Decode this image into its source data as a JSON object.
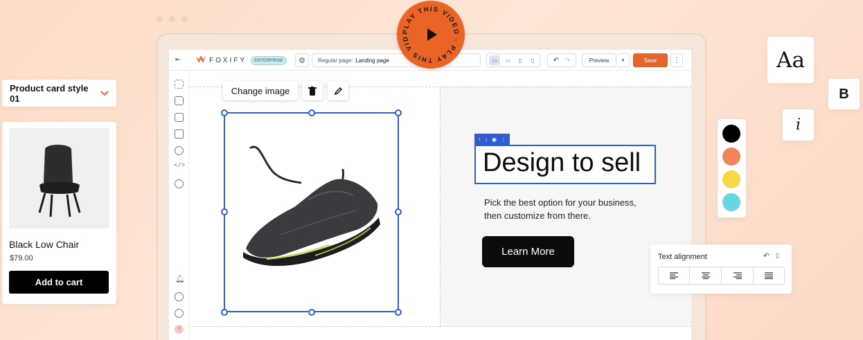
{
  "topbar": {
    "brand": "FOXIFY",
    "badge": "ENTERPRISE",
    "page_prefix": "Regular page:",
    "page_name": "Landing page",
    "preview_label": "Preview",
    "save_label": "Save"
  },
  "image_toolbar": {
    "change_image_label": "Change image"
  },
  "hero": {
    "headline": "Design to sell",
    "description": "Pick the best option for your business, then customize from there.",
    "cta_label": "Learn More"
  },
  "product_card_style": {
    "selected": "Product card style 01"
  },
  "product_card": {
    "name": "Black Low Chair",
    "price": "$79.00",
    "button_label": "Add to cart"
  },
  "typography": {
    "font_sample": "Aa",
    "bold_label": "B",
    "italic_label": "i"
  },
  "colors": {
    "swatches": [
      "#000000",
      "#f0855a",
      "#f6d94a",
      "#69d7e3"
    ],
    "accent": "#e3672d",
    "selection": "#2f5bd3"
  },
  "text_alignment": {
    "title": "Text alignment",
    "options": [
      "align-left",
      "align-center",
      "align-right",
      "align-justify"
    ]
  },
  "play_badge": {
    "ring_text": "PLAY THIS VIDEO · PLAY THIS VIDEO ·"
  }
}
